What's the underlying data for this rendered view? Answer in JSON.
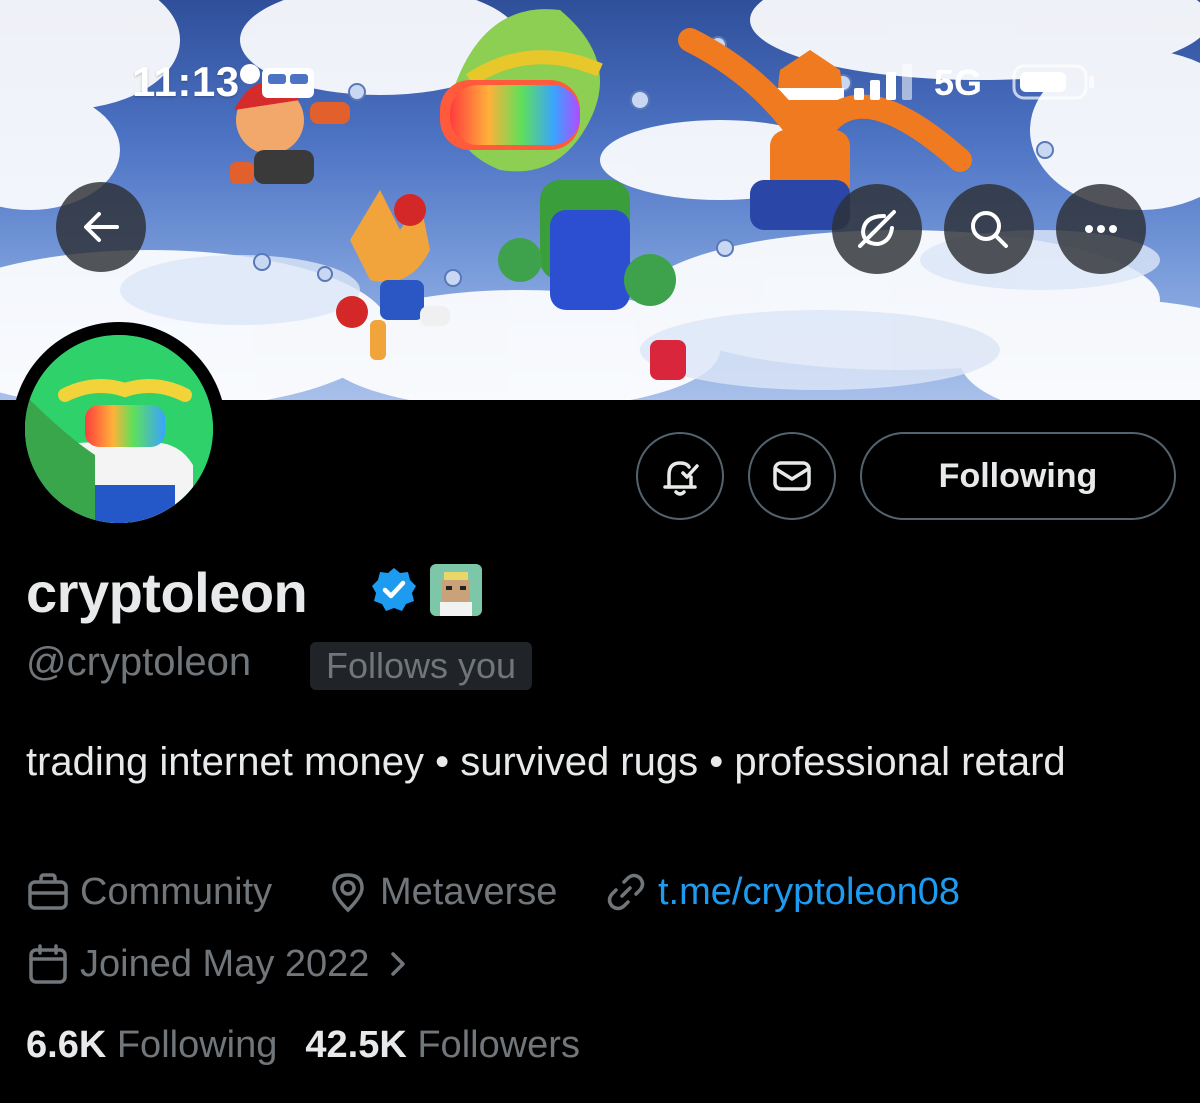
{
  "status_bar": {
    "time": "11:13",
    "network": "5G"
  },
  "banner": {
    "description_colors": {
      "sky": "#4d73c4",
      "cloud": "#ffffff"
    }
  },
  "header_buttons": {
    "back": "arrow-left-icon",
    "grok": "grok-icon",
    "search": "search-icon",
    "more": "more-horizontal-icon"
  },
  "actions": {
    "notifications_icon": "bell-check-icon",
    "message_icon": "envelope-icon",
    "following_label": "Following"
  },
  "profile": {
    "display_name": "cryptoleon",
    "handle": "@cryptoleon",
    "follows_you": "Follows you",
    "bio": "trading internet money • survived rugs • professional retard",
    "category": "Community",
    "location": "Metaverse",
    "website": "t.me/cryptoleon08",
    "joined": "Joined May 2022",
    "following_count": "6.6K",
    "following_label": "Following",
    "followers_count": "42.5K",
    "followers_label": "Followers"
  },
  "colors": {
    "background": "#000000",
    "text_primary": "#e7e9ea",
    "text_secondary": "#71767b",
    "link": "#1d9bf0",
    "verified": "#1d9bf0",
    "border": "#536471"
  }
}
